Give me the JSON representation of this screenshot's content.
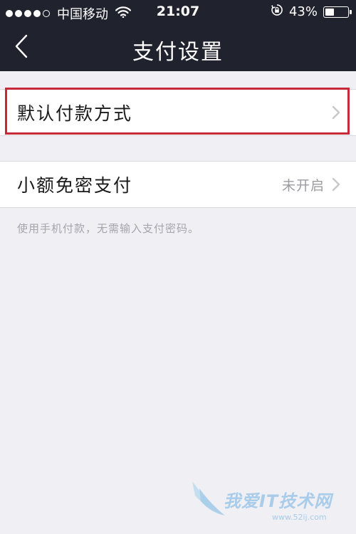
{
  "status_bar": {
    "carrier": "中国移动",
    "time": "21:07",
    "battery": "43%",
    "battery_level": 0.43,
    "signal_bars_filled": 4,
    "signal_bars_total": 5
  },
  "nav": {
    "title": "支付设置"
  },
  "settings": {
    "default_payment": {
      "label": "默认付款方式"
    },
    "small_amount": {
      "label": "小额免密支付",
      "value": "未开启"
    },
    "note": "使用手机付款，无需输入支付密码。"
  },
  "watermark": {
    "text": "我爱IT技术网",
    "sub": "www.52ij.com"
  },
  "colors": {
    "nav_bg": "#20232e",
    "page_bg": "#efeff4",
    "highlight": "#c8293a",
    "secondary_text": "#9b9ba1"
  }
}
